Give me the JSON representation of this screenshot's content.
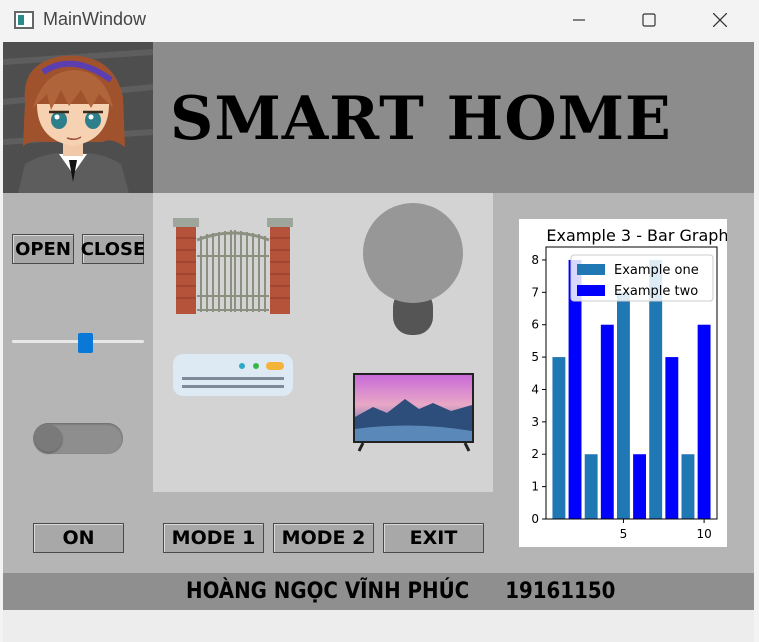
{
  "window": {
    "title": "MainWindow"
  },
  "header": {
    "title": "SMART HOME"
  },
  "gate_controls": {
    "open_label": "OPEN",
    "close_label": "CLOSE"
  },
  "slider": {
    "value_fraction": 0.55
  },
  "toggle": {
    "state": "off"
  },
  "buttons": {
    "on_label": "ON",
    "mode1_label": "MODE 1",
    "mode2_label": "MODE 2",
    "exit_label": "EXIT"
  },
  "footer": {
    "name": "HOÀNG NGỌC VĨNH PHÚC",
    "student_id": "19161150"
  },
  "colors": {
    "series1": "#1f77b4",
    "series2": "#0000ff"
  },
  "chart_data": {
    "type": "bar",
    "title": "Example 3 - Bar Graph",
    "series": [
      {
        "name": "Example one",
        "x": [
          1,
          3,
          5,
          7,
          9
        ],
        "values": [
          5,
          2,
          7,
          8,
          2
        ]
      },
      {
        "name": "Example two",
        "x": [
          2,
          4,
          6,
          8,
          10
        ],
        "values": [
          8,
          6,
          2,
          5,
          6
        ]
      }
    ],
    "xticks": [
      5,
      10
    ],
    "yticks": [
      0,
      1,
      2,
      3,
      4,
      5,
      6,
      7,
      8
    ],
    "xlim": [
      0.2,
      10.8
    ],
    "ylim": [
      0,
      8.4
    ],
    "legend": "top-right",
    "grid": false
  }
}
